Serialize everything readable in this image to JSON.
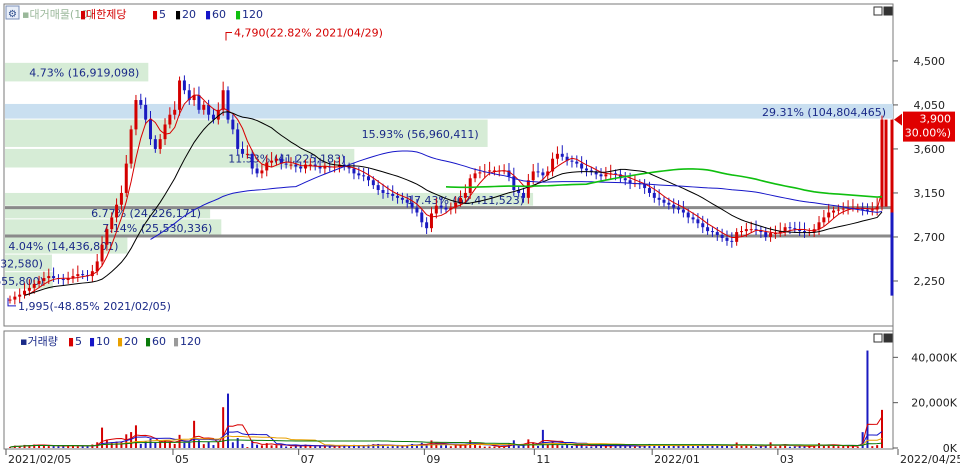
{
  "chart_data": [
    {
      "type": "candlestick",
      "legend": {
        "prefix": "▪대거매물(10)",
        "stock_name": "대한제당",
        "ma_labels": [
          "5",
          "20",
          "60",
          "120"
        ],
        "ma_colors": [
          "#d80000",
          "#000000",
          "#1515c8",
          "#0fbf0f"
        ],
        "placement": "top-left"
      },
      "ylim": [
        1800,
        5000
      ],
      "y_ticks": [
        {
          "value": 2250,
          "label": "2,250"
        },
        {
          "value": 2700,
          "label": "2,700"
        },
        {
          "value": 3150,
          "label": "3,150"
        },
        {
          "value": 3600,
          "label": "3,600"
        },
        {
          "value": 4050,
          "label": "4,050"
        },
        {
          "value": 4500,
          "label": "4,500"
        }
      ],
      "annotations": {
        "high": {
          "value": 4790,
          "label": "4,790(22.82% 2021/04/29)"
        },
        "low": {
          "value": 1995,
          "label": "1,995(-48.85% 2021/02/05)"
        }
      },
      "current": {
        "value": 3900,
        "label": "3,900",
        "change": "( 30.00%)"
      },
      "volume_profile": [
        {
          "low": 3900,
          "high": 4060,
          "label": "29.31% (104,804,465)",
          "highlight": true
        },
        {
          "low": 3610,
          "high": 3900,
          "label": "15.93% (56,960,411)"
        },
        {
          "low": 3400,
          "high": 3600,
          "label": "11.53% (41,225,183)"
        },
        {
          "low": 3010,
          "high": 3150,
          "label": "17.43% (62,411,523)"
        },
        {
          "low": 2880,
          "high": 3010,
          "label": "6.77% (24,226,171)"
        },
        {
          "low": 2700,
          "high": 2880,
          "label": "7.14% (25,530,336)"
        },
        {
          "low": 2520,
          "high": 2700,
          "label": "4.04% (14,436,801)"
        },
        {
          "low": 2340,
          "high": 2520,
          "label": "1.55% (5,532,580)"
        },
        {
          "low": 2160,
          "high": 2340,
          "label": "1.58% (5,655,800)"
        },
        {
          "low": 4280,
          "high": 4480,
          "label": "4.73% (16,919,098)"
        }
      ],
      "support_lines": [
        3000,
        2710
      ],
      "price_series": [
        2060,
        2090,
        2110,
        2150,
        2180,
        2220,
        2250,
        2280,
        2300,
        2280,
        2270,
        2260,
        2280,
        2300,
        2320,
        2310,
        2300,
        2350,
        2450,
        2620,
        2780,
        2900,
        3030,
        3150,
        3450,
        3800,
        4100,
        4050,
        3900,
        3700,
        3600,
        3700,
        3850,
        3950,
        4000,
        4300,
        4200,
        4100,
        4150,
        4000,
        4050,
        3950,
        3900,
        4000,
        4200,
        3900,
        3800,
        3600,
        3550,
        3550,
        3400,
        3350,
        3380,
        3460,
        3480,
        3500,
        3450,
        3440,
        3440,
        3420,
        3400,
        3440,
        3440,
        3420,
        3400,
        3420,
        3410,
        3420,
        3440,
        3420,
        3400,
        3350,
        3330,
        3320,
        3280,
        3230,
        3180,
        3150,
        3140,
        3120,
        3100,
        3080,
        3050,
        3000,
        2950,
        2850,
        2790,
        2940,
        3020,
        3000,
        2980,
        3000,
        3050,
        3100,
        3150,
        3300,
        3350,
        3360,
        3370,
        3380,
        3380,
        3380,
        3380,
        3320,
        3180,
        3150,
        3100,
        3280,
        3370,
        3360,
        3330,
        3370,
        3500,
        3550,
        3520,
        3480,
        3470,
        3450,
        3400,
        3380,
        3370,
        3340,
        3320,
        3340,
        3350,
        3340,
        3300,
        3280,
        3250,
        3250,
        3240,
        3200,
        3150,
        3100,
        3080,
        3050,
        3030,
        3000,
        2980,
        2950,
        2900,
        2880,
        2840,
        2800,
        2760,
        2750,
        2720,
        2690,
        2660,
        2650,
        2750,
        2760,
        2780,
        2780,
        2770,
        2750,
        2700,
        2740,
        2740,
        2760,
        2800,
        2790,
        2780,
        2760,
        2750,
        2750,
        2780,
        2850,
        2900,
        2950,
        2970,
        2980,
        2990,
        3000,
        3000,
        3000,
        2980,
        2970,
        2980,
        3010,
        3900
      ],
      "volume_axis": {
        "legend_title": "▪거래량",
        "legend_labels": [
          "5",
          "10",
          "20",
          "60",
          "120"
        ],
        "legend_colors": [
          "#d80000",
          "#1515c8",
          "#e8a000",
          "#0a7a0a",
          "#9a9a9a"
        ],
        "ylim": [
          0,
          45000
        ],
        "ticks": [
          {
            "value": 0,
            "label": "0K"
          },
          {
            "value": 20000,
            "label": "20,000K"
          },
          {
            "value": 40000,
            "label": "40,000K"
          }
        ]
      },
      "volume_spikes": [
        {
          "index": 45,
          "value": 24000
        },
        {
          "index": 44,
          "value": 18000
        },
        {
          "index": 38,
          "value": 12000
        },
        {
          "index": 26,
          "value": 10000
        },
        {
          "index": 19,
          "value": 9000
        },
        {
          "index": 110,
          "value": 8000
        },
        {
          "index": 177,
          "value": 43000
        },
        {
          "index": 176,
          "value": 7000
        },
        {
          "index": 157,
          "value": 2500
        }
      ],
      "x_labels": [
        {
          "index": 0,
          "label": "2021/02/05"
        },
        {
          "index": 42,
          "label": "05"
        },
        {
          "index": 74,
          "label": "07"
        },
        {
          "index": 106,
          "label": "09"
        },
        {
          "index": 134,
          "label": "11"
        },
        {
          "index": 164,
          "label": "2022/01"
        },
        {
          "index": 196,
          "label": "03"
        },
        {
          "index": 222,
          "label": "2022/04/25"
        }
      ]
    }
  ],
  "window_icons": {
    "maximize": "maximize-icon",
    "close": "close-icon",
    "settings": "settings-icon"
  }
}
